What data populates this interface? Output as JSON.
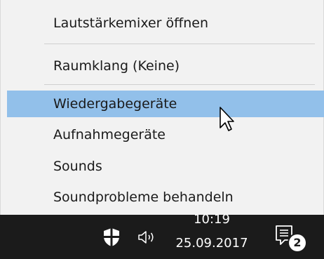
{
  "menu": {
    "items": [
      {
        "label": "Lautstärkemixer öffnen"
      },
      {
        "label": "Raumklang (Keine)"
      },
      {
        "label": "Wiedergabegeräte",
        "highlighted": true
      },
      {
        "label": "Aufnahmegeräte"
      },
      {
        "label": "Sounds"
      },
      {
        "label": "Soundprobleme behandeln"
      }
    ],
    "highlight_color": "#92c0ea"
  },
  "taskbar": {
    "icons": [
      "shield-icon",
      "speaker-icon",
      "notification-icon"
    ],
    "time": "10:19",
    "date": "25.09.2017",
    "notification_count": "2",
    "background": "#1b1b1b"
  }
}
